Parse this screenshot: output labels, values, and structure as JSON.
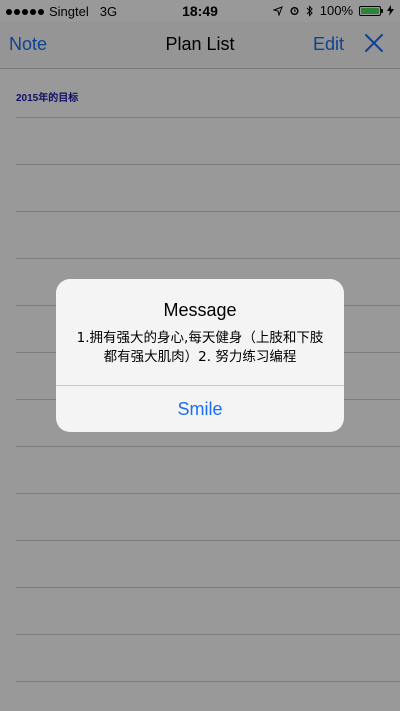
{
  "status_bar": {
    "carrier": "Singtel",
    "network": "3G",
    "time": "18:49",
    "battery": "100%",
    "battery_level": 1.0,
    "icons": [
      "location-icon",
      "alarm-icon",
      "bluetooth-icon",
      "battery-icon",
      "charging-icon"
    ]
  },
  "nav": {
    "back_label": "Note",
    "title": "Plan List",
    "edit_label": "Edit",
    "close_icon": "close-icon"
  },
  "content": {
    "heading": "2015年的目标"
  },
  "alert": {
    "title": "Message",
    "message": "1.拥有强大的身心,每天健身（上肢和下肢都有强大肌肉）2. 努力练习编程",
    "action_label": "Smile"
  },
  "colors": {
    "accent": "#1b6ef3",
    "heading": "#1a1aa8",
    "overlay": "rgba(0,0,0,0.4)"
  }
}
